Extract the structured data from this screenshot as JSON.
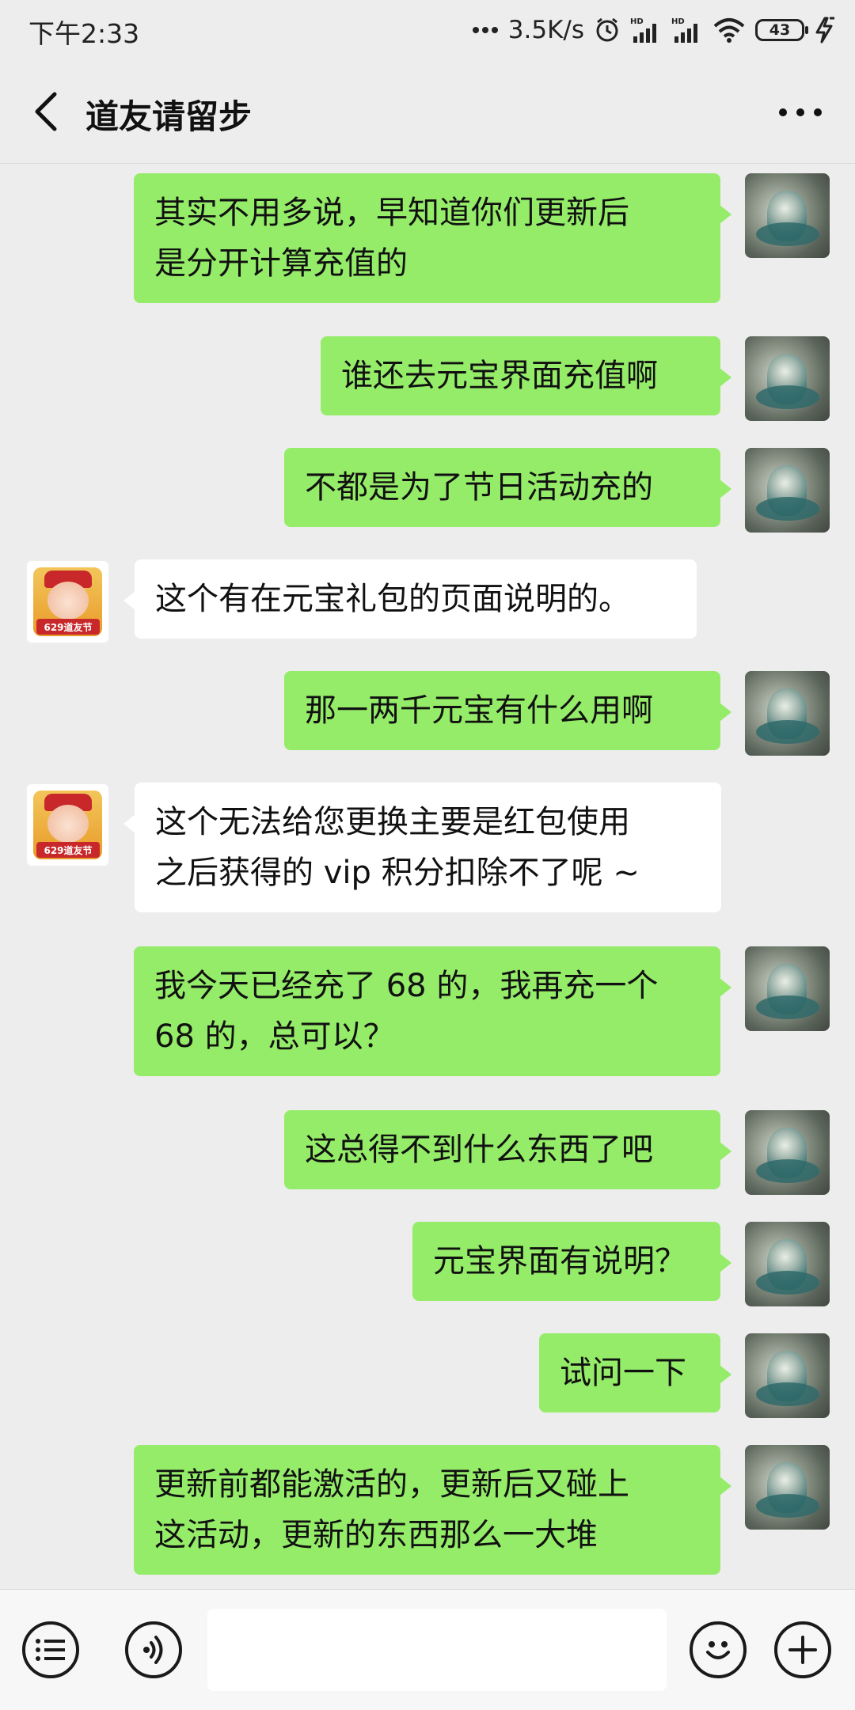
{
  "status_bar": {
    "time": "下午2:33",
    "network_speed": "3.5K/s",
    "battery": "43",
    "hd_label": "HD"
  },
  "header": {
    "title": "道友请留步"
  },
  "messages": [
    {
      "sender": "self",
      "text": "其实不用多说，早知道你们更新后\n是分开计算充值的"
    },
    {
      "sender": "self",
      "text": "谁还去元宝界面充值啊"
    },
    {
      "sender": "self",
      "text": "不都是为了节日活动充的"
    },
    {
      "sender": "other",
      "text": "这个有在元宝礼包的页面说明的。"
    },
    {
      "sender": "self",
      "text": "那一两千元宝有什么用啊"
    },
    {
      "sender": "other",
      "text": "这个无法给您更换主要是红包使用\n之后获得的 vip 积分扣除不了呢 ~"
    },
    {
      "sender": "self",
      "text": "我今天已经充了 68 的，我再充一个\n68 的，总可以？"
    },
    {
      "sender": "self",
      "text": "这总得不到什么东西了吧"
    },
    {
      "sender": "self",
      "text": "元宝界面有说明？"
    },
    {
      "sender": "self",
      "text": "试问一下"
    },
    {
      "sender": "self",
      "text": "更新前都能激活的，更新后又碰上\n这活动，更新的东西那么一大堆"
    }
  ],
  "avatars": {
    "other_badge": "629道友节"
  },
  "input_bar": {
    "placeholder": ""
  },
  "colors": {
    "self_bubble": "#95ec69",
    "other_bubble": "#ffffff",
    "background": "#ededed"
  }
}
